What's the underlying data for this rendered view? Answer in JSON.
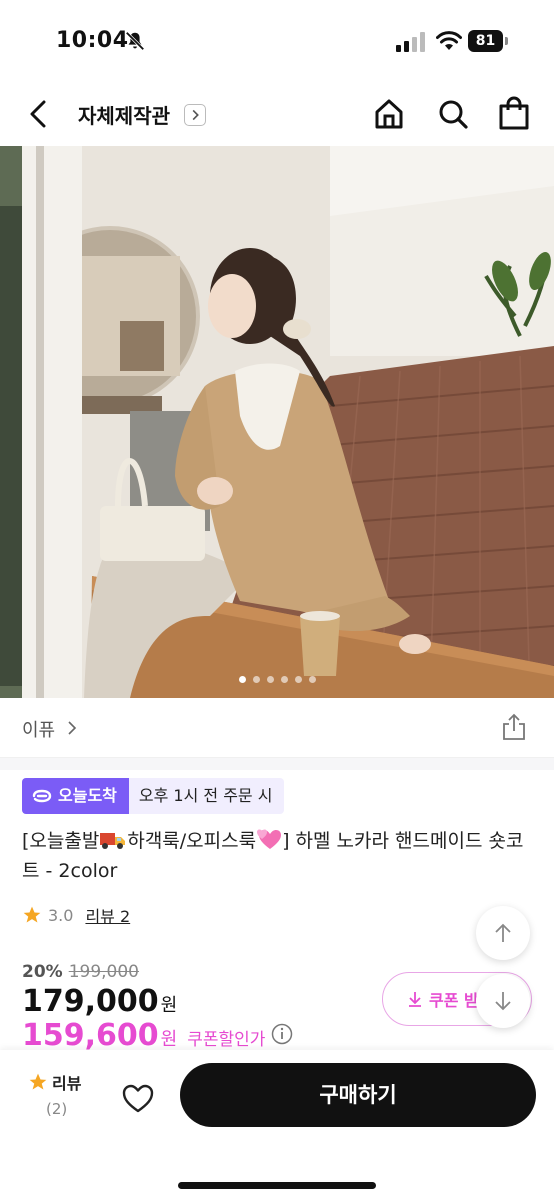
{
  "status_bar": {
    "time": "10:04",
    "battery": "81"
  },
  "nav": {
    "store_name": "자체제작관"
  },
  "hero": {
    "slide_count": 6,
    "active_slide": 1,
    "colors": {
      "coat": "#c9a478",
      "wall": "#ece8e1",
      "brick": "#8a5a46",
      "bench": "#b57c4a"
    }
  },
  "brand": {
    "name": "이퓨"
  },
  "delivery": {
    "badge": "오늘도착",
    "cutoff": "오후 1시 전 주문 시"
  },
  "product": {
    "title_part1": "[오늘출발",
    "title_part2": "하객룩/오피스룩",
    "title_part3": "] 하멜 노카라 핸드메이드 숏코트 - 2color",
    "rating": "3.0",
    "reviews": "리뷰 2",
    "discount_rate": "20%",
    "original_price": "199,000",
    "price": "179,000",
    "price_unit": "원",
    "coupon_price": "159,600",
    "coupon_unit": "원",
    "coupon_label": "쿠폰할인가",
    "coupon_button": "쿠폰 받"
  },
  "bottom_bar": {
    "review_label": "리뷰",
    "review_count": "(2)",
    "buy_label": "구매하기"
  },
  "colors": {
    "accent_purple": "#7b5cf6",
    "accent_pink": "#e64bd1",
    "star": "#f5a623"
  }
}
